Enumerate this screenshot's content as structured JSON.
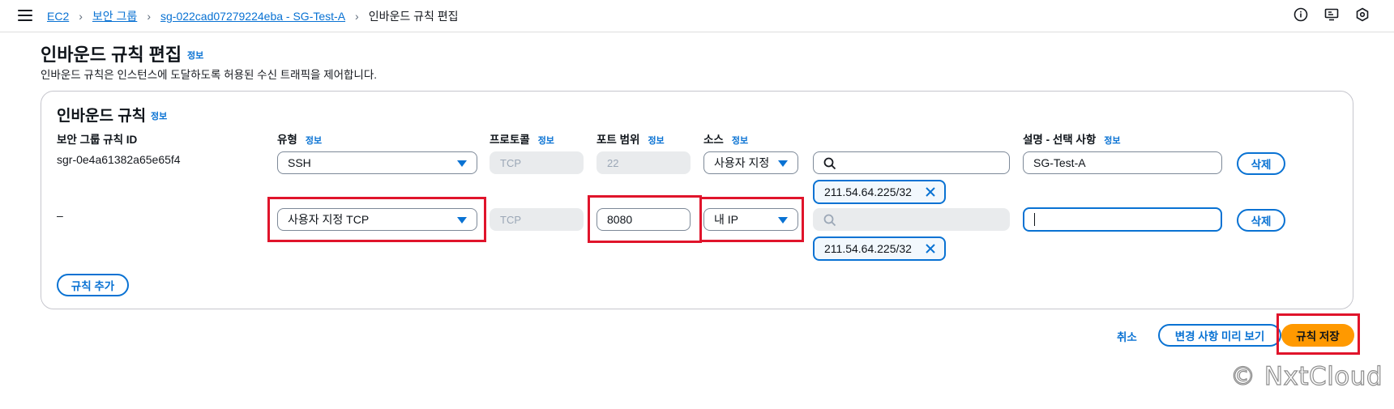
{
  "breadcrumb": {
    "items": [
      "EC2",
      "보안 그룹",
      "sg-022cad07279224eba - SG-Test-A"
    ],
    "current": "인바운드 규칙 편집"
  },
  "top_icons": [
    "info-circle-icon",
    "monitor-icon",
    "settings-hex-icon"
  ],
  "page": {
    "title": "인바운드 규칙 편집",
    "info": "정보",
    "description": "인바운드 규칙은 인스턴스에 도달하도록 허용된 수신 트래픽을 제어합니다."
  },
  "section": {
    "title": "인바운드 규칙",
    "info": "정보",
    "columns": {
      "rule_id": "보안 그룹 규칙 ID",
      "type": "유형",
      "protocol": "프로토콜",
      "port_range": "포트 범위",
      "source": "소스",
      "description": "설명 - 선택 사항"
    },
    "col_info": "정보"
  },
  "rules": [
    {
      "id": "sgr-0e4a61382a65e65f4",
      "type": "SSH",
      "protocol": "TCP",
      "port": "22",
      "source": "사용자 지정",
      "search_value": "",
      "token": "211.54.64.225/32",
      "description": "SG-Test-A",
      "delete": "삭제"
    },
    {
      "id": "–",
      "type": "사용자 지정 TCP",
      "protocol": "TCP",
      "port": "8080",
      "source": "내 IP",
      "search_value": "",
      "token": "211.54.64.225/32",
      "description": "",
      "delete": "삭제"
    }
  ],
  "add_rule": "규칙 추가",
  "footer": {
    "cancel": "취소",
    "preview": "변경 사항 미리 보기",
    "save": "규칙 저장"
  },
  "watermark": "© NxtCloud",
  "colors": {
    "accent": "#0972d3",
    "primary_button": "#ff9900",
    "highlight": "#e0142b"
  }
}
